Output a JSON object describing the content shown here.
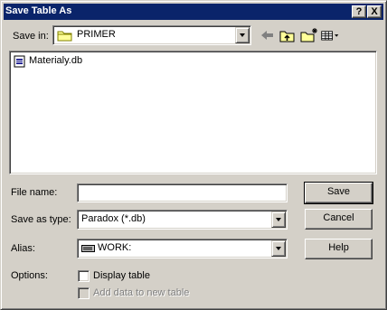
{
  "dialog": {
    "title": "Save Table As",
    "help_button": "?",
    "close_button": "X"
  },
  "save_in": {
    "label": "Save in:",
    "value": "PRIMER"
  },
  "files": [
    {
      "name": "Materialy.db"
    }
  ],
  "file_name": {
    "label": "File name:",
    "value": ""
  },
  "save_as_type": {
    "label": "Save as type:",
    "value": "Paradox (*.db)"
  },
  "alias": {
    "label": "Alias:",
    "value": "WORK:"
  },
  "options": {
    "label": "Options:",
    "display_table": "Display table",
    "display_table_checked": false,
    "add_data": "Add data to new table",
    "add_data_checked": false,
    "add_data_enabled": false
  },
  "buttons": {
    "save": "Save",
    "cancel": "Cancel",
    "help": "Help"
  },
  "colors": {
    "titlebar": "#0a246a",
    "face": "#d4d0c8"
  }
}
